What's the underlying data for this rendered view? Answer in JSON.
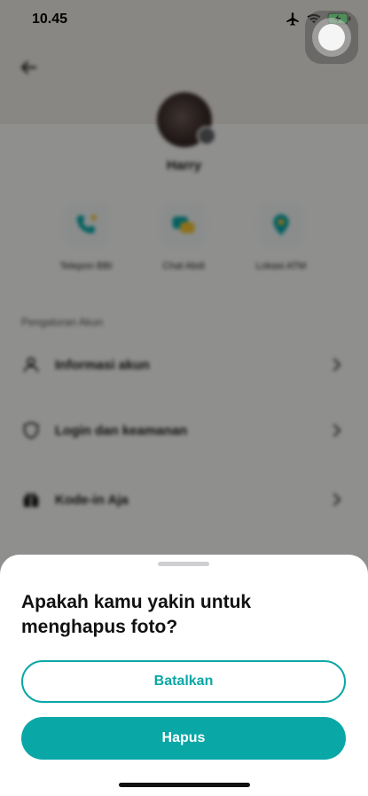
{
  "status_bar": {
    "time": "10.45",
    "icons": [
      "airplane-icon",
      "wifi-icon",
      "battery-charging-icon"
    ]
  },
  "background_page": {
    "profile_name": "Harry",
    "quick_actions": [
      {
        "label": "Telepon BBI",
        "icon": "phone-icon"
      },
      {
        "label": "Chat Abdi",
        "icon": "chat-icon"
      },
      {
        "label": "Lokasi ATM",
        "icon": "location-pin-icon"
      }
    ],
    "section_title": "Pengaturan Akun",
    "menu_items": [
      {
        "label": "Informasi akun",
        "icon": "person-icon"
      },
      {
        "label": "Login dan keamanan",
        "icon": "shield-icon"
      },
      {
        "label": "Kode-in Aja",
        "icon": "gift-icon"
      }
    ]
  },
  "dialog": {
    "title": "Apakah kamu yakin untuk menghapus foto?",
    "cancel_label": "Batalkan",
    "delete_label": "Hapus"
  },
  "colors": {
    "accent": "#0aa7a7",
    "sheet_background": "#ffffff",
    "scrim": "rgba(0,0,0,0.42)"
  }
}
